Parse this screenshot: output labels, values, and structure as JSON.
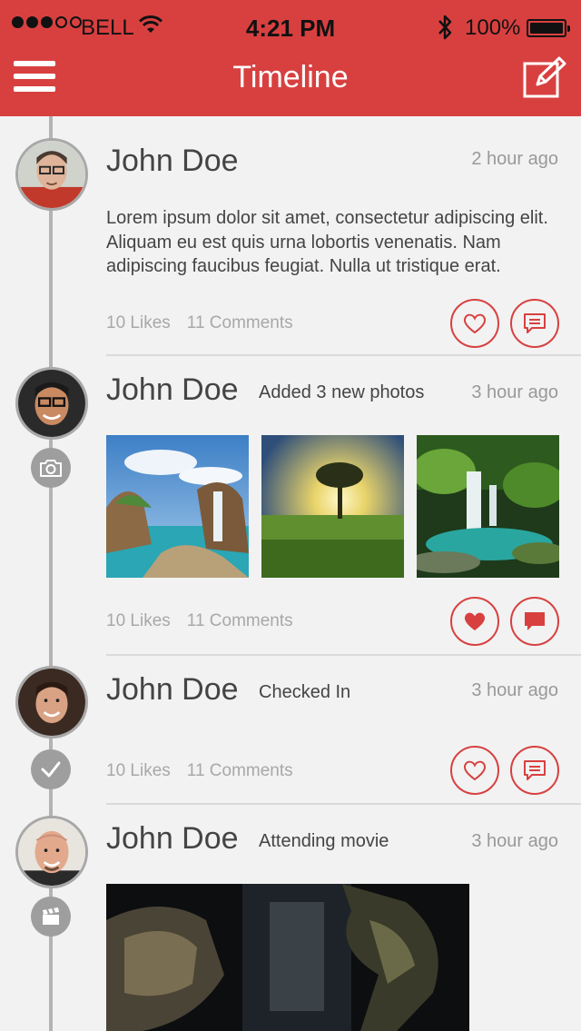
{
  "status_bar": {
    "carrier": "BELL",
    "time": "4:21 PM",
    "battery": "100%",
    "signal_bars_filled": 3,
    "signal_bars_total": 5
  },
  "header": {
    "title": "Timeline",
    "menu_icon": "hamburger-menu-icon",
    "compose_icon": "compose-icon",
    "background_color": "#d84040"
  },
  "posts": [
    {
      "name": "John Doe",
      "action": "",
      "time": "2 hour ago",
      "text": "Lorem ipsum dolor sit amet, consectetur adipiscing elit. Aliquam eu est quis urna lobortis venenatis. Nam adipiscing faucibus feugiat. Nulla ut tristique erat.",
      "likes": "10 Likes",
      "comments": "11 Comments",
      "liked": false
    },
    {
      "name": "John Doe",
      "action": "Added 3 new photos",
      "time": "3 hour ago",
      "type_icon": "camera-icon",
      "likes": "10 Likes",
      "comments": "11 Comments",
      "liked": true
    },
    {
      "name": "John Doe",
      "action": "Checked In",
      "time": "3 hour ago",
      "type_icon": "checkmark-icon",
      "likes": "10 Likes",
      "comments": "11 Comments",
      "liked": false
    },
    {
      "name": "John Doe",
      "action": "Attending movie",
      "time": "3 hour ago",
      "type_icon": "clapperboard-icon"
    }
  ]
}
